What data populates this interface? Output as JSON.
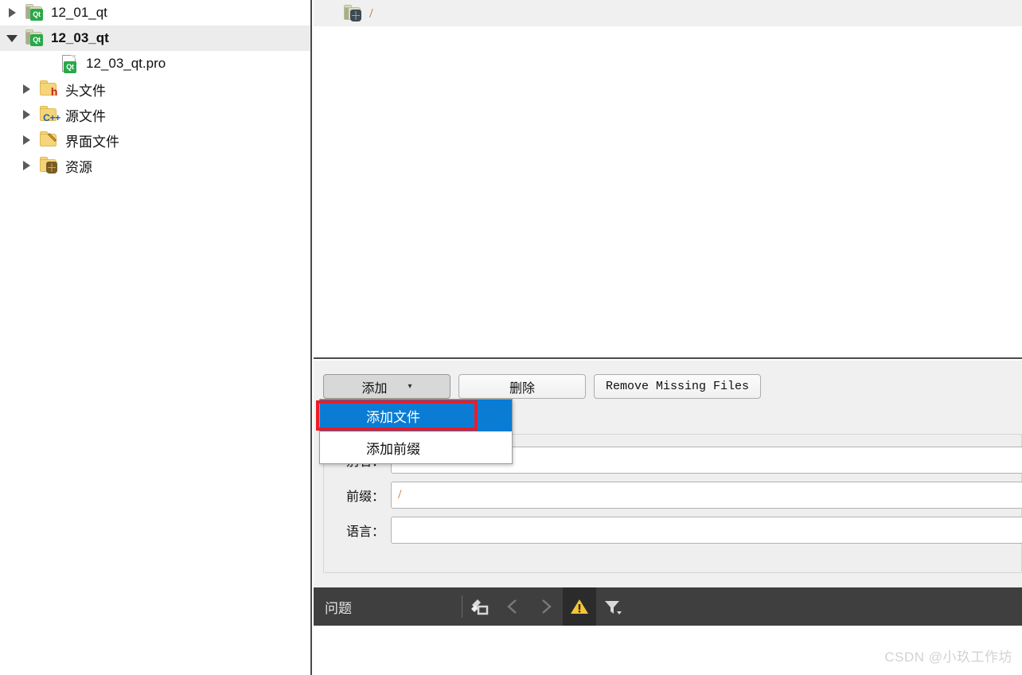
{
  "project_tree": {
    "items": [
      {
        "label": "12_01_qt",
        "icon": "qt-project-folder-icon",
        "twisty": "collapsed",
        "indent": 8,
        "selected": false,
        "bold": false
      },
      {
        "label": "12_03_qt",
        "icon": "qt-project-folder-icon",
        "twisty": "expanded",
        "indent": 8,
        "selected": true,
        "bold": true
      },
      {
        "label": "12_03_qt.pro",
        "icon": "qt-pro-file-icon",
        "twisty": "none",
        "indent": 52,
        "selected": false,
        "bold": false
      },
      {
        "label": "头文件",
        "icon": "headers-folder-icon",
        "twisty": "collapsed",
        "indent": 26,
        "selected": false,
        "bold": false
      },
      {
        "label": "源文件",
        "icon": "sources-folder-icon",
        "twisty": "collapsed",
        "indent": 26,
        "selected": false,
        "bold": false
      },
      {
        "label": "界面文件",
        "icon": "forms-folder-icon",
        "twisty": "collapsed",
        "indent": 26,
        "selected": false,
        "bold": false
      },
      {
        "label": "资源",
        "icon": "resources-folder-icon",
        "twisty": "collapsed",
        "indent": 26,
        "selected": false,
        "bold": false
      }
    ]
  },
  "resource_editor": {
    "path_icon": "resource-prefix-icon",
    "path_text": "/",
    "buttons": {
      "add_label": "添加",
      "add_caret": "▾",
      "remove_label": "删除",
      "remove_missing_label": "Remove Missing Files"
    },
    "menu": {
      "items": [
        {
          "label": "添加文件",
          "highlighted": true
        },
        {
          "label": "添加前缀",
          "highlighted": false
        }
      ]
    },
    "form": {
      "rows": [
        {
          "label": "别名：",
          "value": ""
        },
        {
          "label": "前缀：",
          "value": "/"
        },
        {
          "label": "语言：",
          "value": ""
        }
      ]
    }
  },
  "issues_bar": {
    "label": "问题",
    "icons": [
      {
        "name": "clear-pane-icon",
        "active": false
      },
      {
        "name": "previous-item-icon",
        "active": false,
        "glyph": "❬"
      },
      {
        "name": "next-item-icon",
        "active": false,
        "glyph": "❭"
      },
      {
        "name": "warning-icon",
        "active": true
      },
      {
        "name": "filter-icon",
        "active": false
      }
    ]
  },
  "watermark": {
    "text": "CSDN @小玖工作坊"
  },
  "colors": {
    "menu_highlight": "#0a7cd4",
    "annotation_red": "#ee1c25",
    "issues_bar_bg": "#3f3f3f",
    "warning_yellow": "#f2c43d",
    "path_text": "#c06010"
  }
}
